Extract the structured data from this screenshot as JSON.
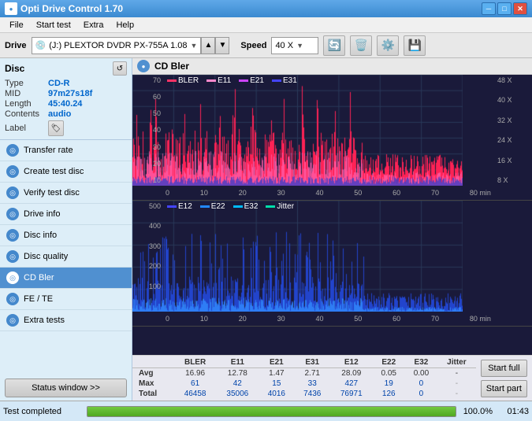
{
  "window": {
    "title": "Opti Drive Control 1.70",
    "controls": [
      "─",
      "□",
      "✕"
    ]
  },
  "menu": {
    "items": [
      "File",
      "Start test",
      "Extra",
      "Help"
    ]
  },
  "drive_bar": {
    "drive_label": "Drive",
    "drive_value": "(J:)  PLEXTOR DVDR   PX-755A 1.08",
    "speed_label": "Speed",
    "speed_value": "40 X"
  },
  "disc": {
    "title": "Disc",
    "type_label": "Type",
    "type_value": "CD-R",
    "mid_label": "MID",
    "mid_value": "97m27s18f",
    "length_label": "Length",
    "length_value": "45:40.24",
    "contents_label": "Contents",
    "contents_value": "audio",
    "label_label": "Label"
  },
  "nav": {
    "items": [
      {
        "id": "transfer-rate",
        "label": "Transfer rate",
        "active": false
      },
      {
        "id": "create-test-disc",
        "label": "Create test disc",
        "active": false
      },
      {
        "id": "verify-test-disc",
        "label": "Verify test disc",
        "active": false
      },
      {
        "id": "drive-info",
        "label": "Drive info",
        "active": false
      },
      {
        "id": "disc-info",
        "label": "Disc info",
        "active": false
      },
      {
        "id": "disc-quality",
        "label": "Disc quality",
        "active": false
      },
      {
        "id": "cd-bler",
        "label": "CD Bler",
        "active": true
      },
      {
        "id": "fe-te",
        "label": "FE / TE",
        "active": false
      },
      {
        "id": "extra-tests",
        "label": "Extra tests",
        "active": false
      }
    ],
    "status_window_label": "Status window >>"
  },
  "chart": {
    "title": "CD Bler",
    "top": {
      "legend": [
        {
          "label": "BLER",
          "color": "#ff3366"
        },
        {
          "label": "E11",
          "color": "#ff88cc"
        },
        {
          "label": "E21",
          "color": "#cc44ff"
        },
        {
          "label": "E31",
          "color": "#4444ff"
        }
      ],
      "y_axis": [
        "70",
        "60",
        "50",
        "40",
        "30",
        "20",
        "10"
      ],
      "y_axis_right": [
        "48 X",
        "40 X",
        "32 X",
        "24 X",
        "16 X",
        "8 X"
      ],
      "x_axis": [
        "0",
        "10",
        "20",
        "30",
        "40",
        "50",
        "60",
        "70",
        "80 min"
      ]
    },
    "bottom": {
      "legend": [
        {
          "label": "E12",
          "color": "#4444ff"
        },
        {
          "label": "E22",
          "color": "#2288ff"
        },
        {
          "label": "E32",
          "color": "#00bbff"
        },
        {
          "label": "Jitter",
          "color": "#00ddaa"
        }
      ],
      "y_axis": [
        "500",
        "400",
        "300",
        "200",
        "100"
      ],
      "x_axis": [
        "0",
        "10",
        "20",
        "30",
        "40",
        "50",
        "60",
        "70",
        "80 min"
      ]
    }
  },
  "stats": {
    "headers": [
      "",
      "BLER",
      "E11",
      "E21",
      "E31",
      "E12",
      "E22",
      "E32",
      "Jitter"
    ],
    "rows": [
      {
        "label": "Avg",
        "values": [
          "16.96",
          "12.78",
          "1.47",
          "2.71",
          "28.09",
          "0.05",
          "0.00",
          "-"
        ]
      },
      {
        "label": "Max",
        "values": [
          "61",
          "42",
          "15",
          "33",
          "427",
          "19",
          "0",
          "-"
        ]
      },
      {
        "label": "Total",
        "values": [
          "46458",
          "35006",
          "4016",
          "7436",
          "76971",
          "126",
          "0",
          "-"
        ]
      }
    ],
    "buttons": {
      "start_full": "Start full",
      "start_part": "Start part"
    }
  },
  "status": {
    "text": "Test completed",
    "progress": 100.0,
    "progress_label": "100.0%",
    "elapsed": "01:43"
  }
}
